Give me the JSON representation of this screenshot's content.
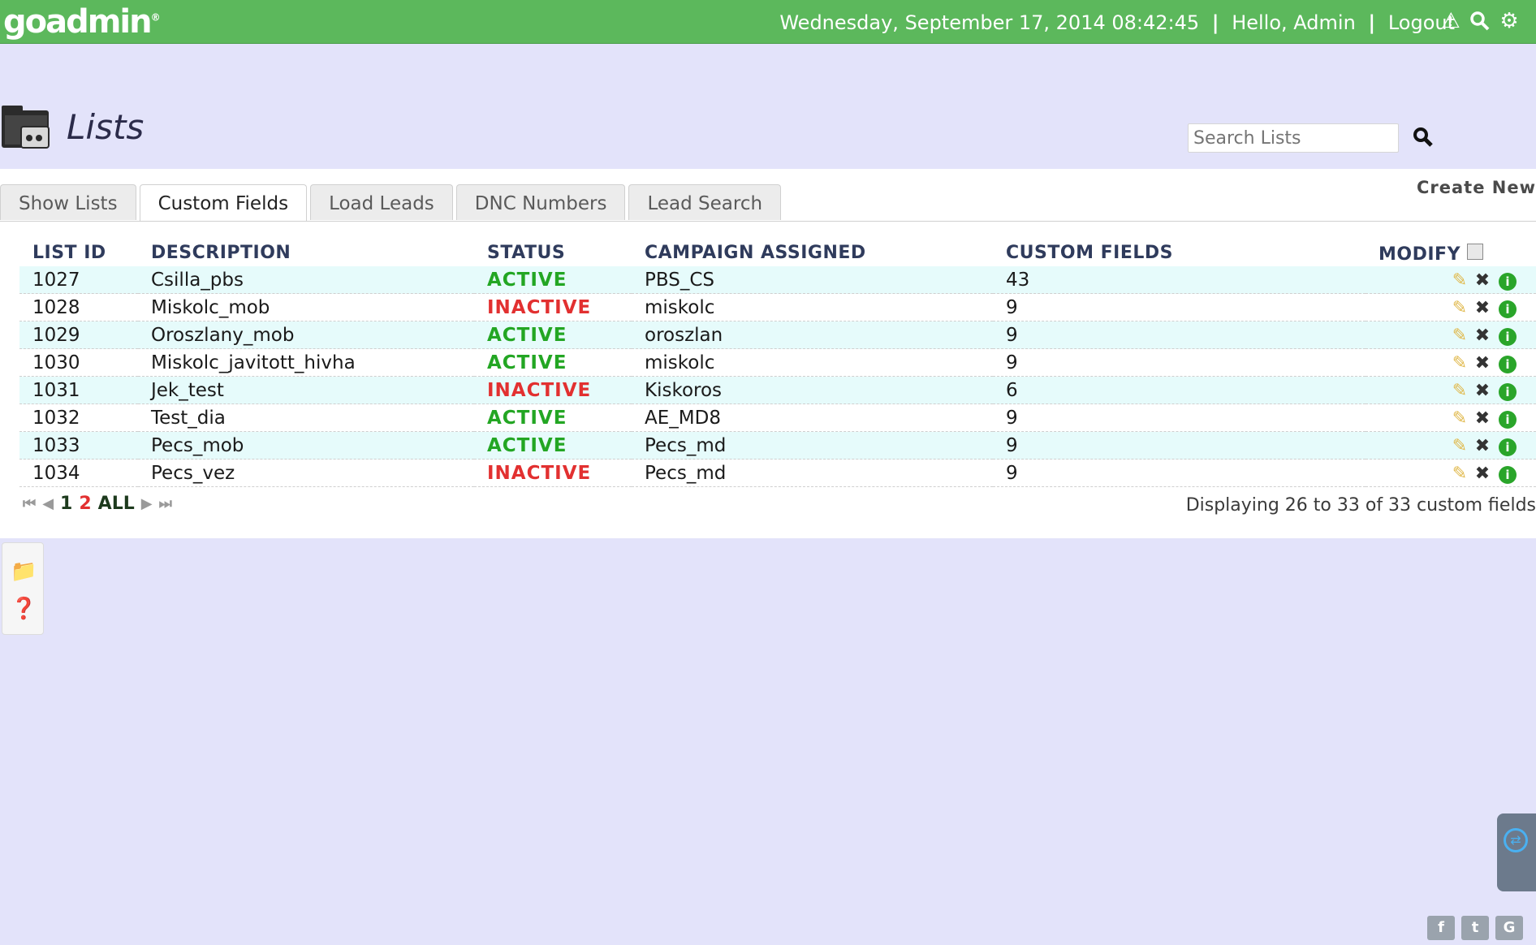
{
  "brand": {
    "logo_text": "goadmin"
  },
  "topbar": {
    "datetime": "Wednesday, September 17, 2014 08:42:45",
    "greeting": "Hello, Admin",
    "logout": "Logout",
    "separator": "|",
    "icons": [
      "warning-icon",
      "search-icon",
      "gear-icon"
    ]
  },
  "page": {
    "title": "Lists",
    "search_placeholder": "Search Lists",
    "create_new": "Create New"
  },
  "tabs": [
    {
      "label": "Show Lists",
      "active": false
    },
    {
      "label": "Custom Fields",
      "active": true
    },
    {
      "label": "Load Leads",
      "active": false
    },
    {
      "label": "DNC Numbers",
      "active": false
    },
    {
      "label": "Lead Search",
      "active": false
    }
  ],
  "table": {
    "headers": [
      "LIST ID",
      "DESCRIPTION",
      "STATUS",
      "CAMPAIGN ASSIGNED",
      "CUSTOM FIELDS",
      "MODIFY"
    ],
    "rows": [
      {
        "list_id": "1027",
        "description": "Csilla_pbs",
        "status": "ACTIVE",
        "campaign": "PBS_CS",
        "custom_fields": "43"
      },
      {
        "list_id": "1028",
        "description": "Miskolc_mob",
        "status": "INACTIVE",
        "campaign": "miskolc",
        "custom_fields": "9"
      },
      {
        "list_id": "1029",
        "description": "Oroszlany_mob",
        "status": "ACTIVE",
        "campaign": "oroszlan",
        "custom_fields": "9"
      },
      {
        "list_id": "1030",
        "description": "Miskolc_javitott_hivha",
        "status": "ACTIVE",
        "campaign": "miskolc",
        "custom_fields": "9"
      },
      {
        "list_id": "1031",
        "description": "Jek_test",
        "status": "INACTIVE",
        "campaign": "Kiskoros",
        "custom_fields": "6"
      },
      {
        "list_id": "1032",
        "description": "Test_dia",
        "status": "ACTIVE",
        "campaign": "AE_MD8",
        "custom_fields": "9"
      },
      {
        "list_id": "1033",
        "description": "Pecs_mob",
        "status": "ACTIVE",
        "campaign": "Pecs_md",
        "custom_fields": "9"
      },
      {
        "list_id": "1034",
        "description": "Pecs_vez",
        "status": "INACTIVE",
        "campaign": "Pecs_md",
        "custom_fields": "9"
      }
    ]
  },
  "pager": {
    "pages": [
      "1",
      "2",
      "ALL"
    ],
    "current": "2",
    "displaying": "Displaying 26 to 33 of 33 custom fields"
  },
  "colors": {
    "topbar": "#5cb85c",
    "background": "#e3e3fa",
    "active": "#23a623",
    "inactive": "#e23030",
    "header_text": "#2f3b5c"
  }
}
